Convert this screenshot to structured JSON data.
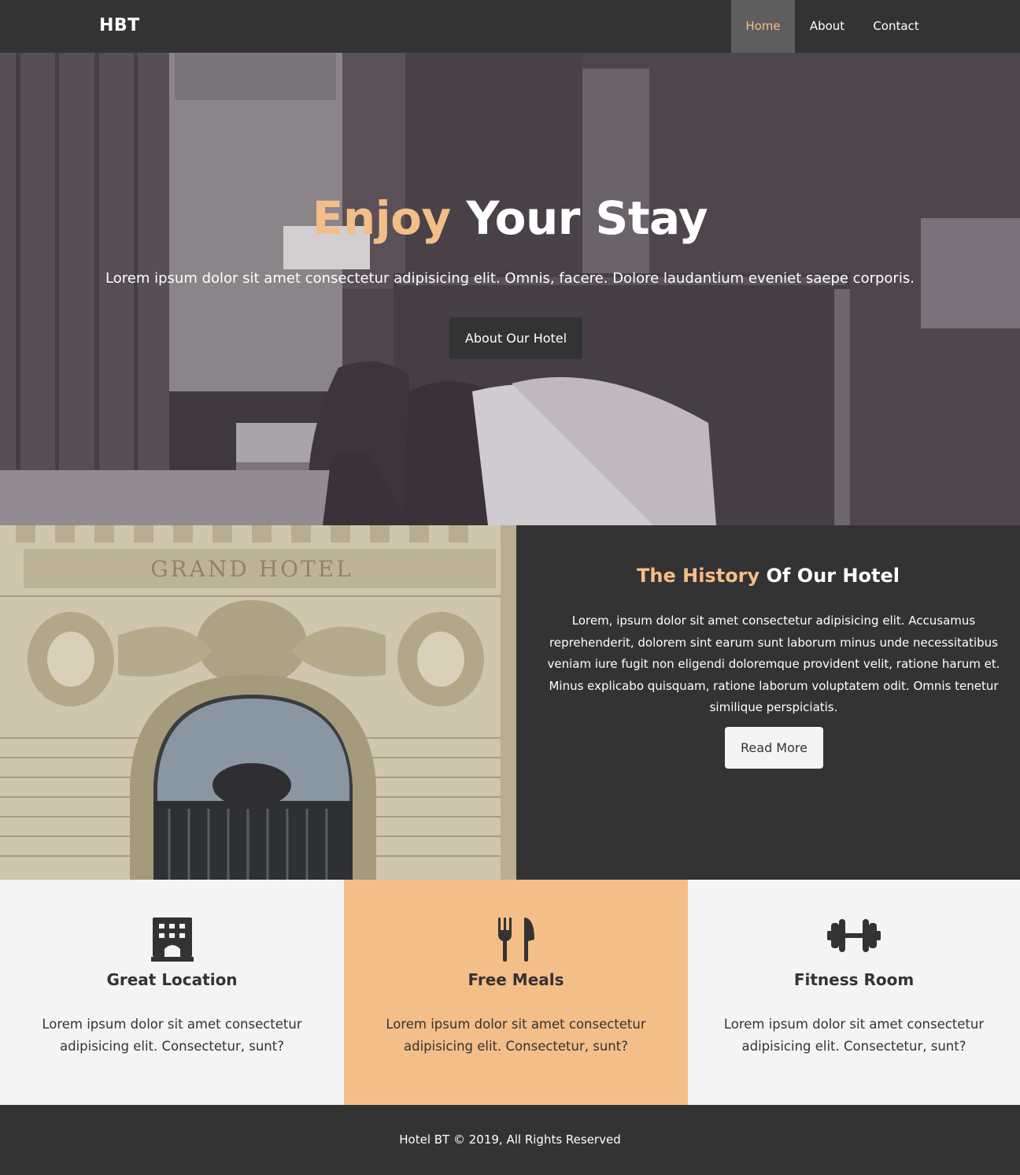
{
  "nav": {
    "logo": "HBT",
    "items": [
      {
        "label": "Home",
        "active": true
      },
      {
        "label": "About"
      },
      {
        "label": "Contact"
      }
    ]
  },
  "hero": {
    "title_accent": "Enjoy",
    "title_rest": "Your Stay",
    "subtitle": "Lorem ipsum dolor sit amet consectetur adipisicing elit. Omnis, facere. Dolore laudantium eveniet saepe corporis.",
    "button_label": "About Our Hotel"
  },
  "history": {
    "image_sign_text": "GRAND HOTEL",
    "title_accent": "The History",
    "title_rest": "Of Our Hotel",
    "text": "Lorem, ipsum dolor sit amet consectetur adipisicing elit. Accusamus reprehenderit, dolorem sint earum sunt laborum minus unde necessitatibus veniam iure fugit non eligendi doloremque provident velit, ratione harum et. Minus explicabo quisquam, ratione laborum voluptatem odit. Omnis tenetur similique perspiciatis.",
    "button_label": "Read More"
  },
  "features": [
    {
      "icon": "building-icon",
      "title": "Great Location",
      "text": "Lorem ipsum dolor sit amet consectetur adipisicing elit. Consectetur, sunt?"
    },
    {
      "icon": "utensils-icon",
      "title": "Free Meals",
      "text": "Lorem ipsum dolor sit amet consectetur adipisicing elit. Consectetur, sunt?"
    },
    {
      "icon": "dumbbell-icon",
      "title": "Fitness Room",
      "text": "Lorem ipsum dolor sit amet consectetur adipisicing elit. Consectetur, sunt?"
    }
  ],
  "footer": {
    "text": "Hotel BT © 2019, All Rights Reserved"
  },
  "colors": {
    "dark": "#333333",
    "accent": "#f4be88",
    "light": "#f4f4f4",
    "hero_overlay": "#4f464d"
  }
}
